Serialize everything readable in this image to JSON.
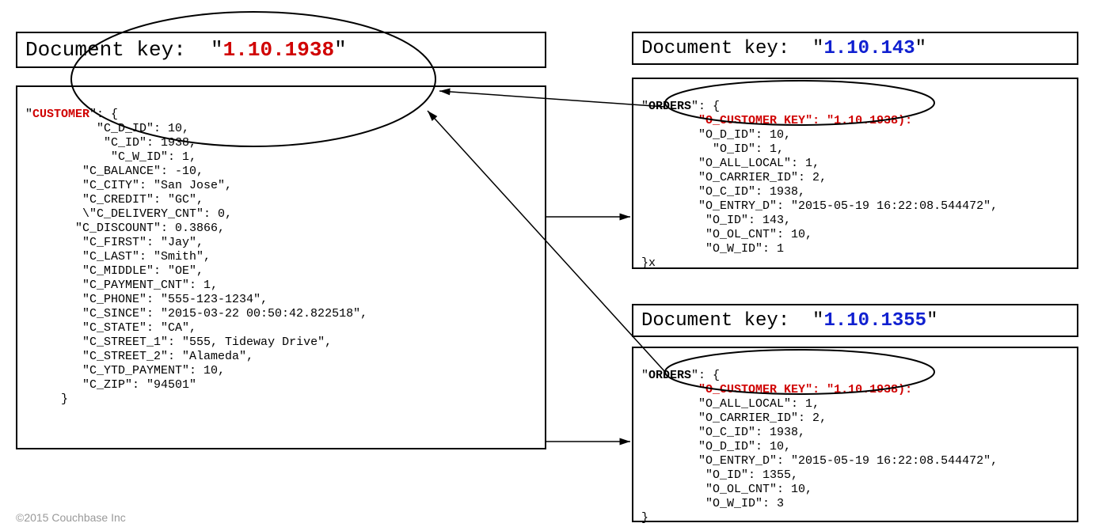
{
  "footer": "©2015 Couchbase Inc",
  "customer": {
    "header_label": "Document key:",
    "document_key": "1.10.1938",
    "section_name": "CUSTOMER",
    "fields": {
      "C_D_ID": 10,
      "C_ID": 1938,
      "C_W_ID": 1,
      "C_BALANCE": -10,
      "C_CITY": "San Jose",
      "C_CREDIT": "GC",
      "C_DELIVERY_CNT": 0,
      "C_DISCOUNT": 0.3866,
      "C_FIRST": "Jay",
      "C_LAST": "Smith",
      "C_MIDDLE": "OE",
      "C_PAYMENT_CNT": 1,
      "C_PHONE": "555-123-1234",
      "C_SINCE": "2015-03-22 00:50:42.822518",
      "C_STATE": "CA",
      "C_STREET_1": "555, Tideway Drive",
      "C_STREET_2": "Alameda",
      "C_YTD_PAYMENT": 10,
      "C_ZIP": "94501"
    }
  },
  "order1": {
    "header_label": "Document key:",
    "document_key": "1.10.143",
    "section_name": "ORDERS",
    "foreign_key_field": "O_CUSTOMER_KEY",
    "foreign_key_value": "1.10.1938",
    "fields": {
      "O_D_ID": 10,
      "O_ID_inner": 1,
      "O_ALL_LOCAL": 1,
      "O_CARRIER_ID": 2,
      "O_C_ID": 1938,
      "O_ENTRY_D": "2015-05-19 16:22:08.544472",
      "O_ID": 143,
      "O_OL_CNT": 10,
      "O_W_ID": 1
    },
    "trailer": "}x"
  },
  "order2": {
    "header_label": "Document key:",
    "document_key": "1.10.1355",
    "section_name": "ORDERS",
    "foreign_key_field": "O_CUSTOMER_KEY",
    "foreign_key_value": "1.10.1938",
    "fields": {
      "O_ALL_LOCAL": 1,
      "O_CARRIER_ID": 2,
      "O_C_ID": 1938,
      "O_D_ID": 10,
      "O_ENTRY_D": "2015-05-19 16:22:08.544472",
      "O_ID": 1355,
      "O_OL_CNT": 10,
      "O_W_ID": 3
    },
    "trailer": "}"
  }
}
